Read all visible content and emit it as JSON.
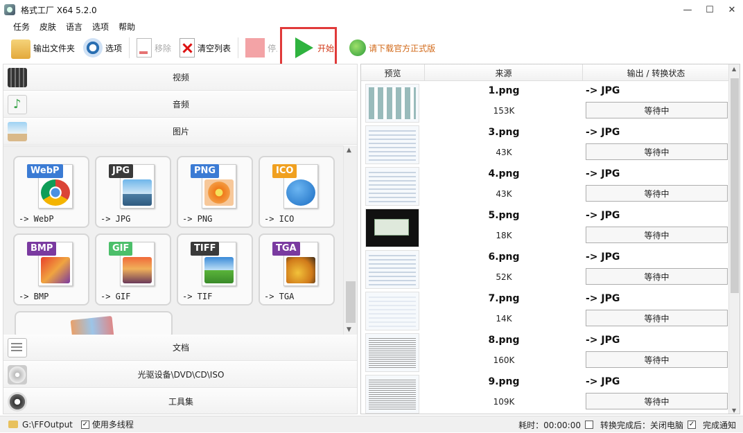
{
  "window": {
    "title": "格式工厂 X64 5.2.0",
    "min": "—",
    "max": "☐",
    "close": "✕"
  },
  "menu": [
    "任务",
    "皮肤",
    "语言",
    "选项",
    "帮助"
  ],
  "toolbar": {
    "output_folder": "输出文件夹",
    "options": "选项",
    "remove": "移除",
    "clear_list": "清空列表",
    "stop": "停止",
    "start": "开始",
    "download": "请下载官方正式版"
  },
  "categories": {
    "video": "视频",
    "audio": "音频",
    "image": "图片",
    "document": "文档",
    "disc": "光驱设备\\DVD\\CD\\ISO",
    "tools": "工具集"
  },
  "formats": [
    {
      "badge": "WebP",
      "label": "-> WebP",
      "color": "#3b7bd4"
    },
    {
      "badge": "JPG",
      "label": "-> JPG",
      "color": "#3a3a3a"
    },
    {
      "badge": "PNG",
      "label": "-> PNG",
      "color": "#3b7bd4"
    },
    {
      "badge": "ICO",
      "label": "-> ICO",
      "color": "#f0a020"
    },
    {
      "badge": "BMP",
      "label": "-> BMP",
      "color": "#7a3aa0"
    },
    {
      "badge": "GIF",
      "label": "-> GIF",
      "color": "#4cbf6a"
    },
    {
      "badge": "TIFF",
      "label": "-> TIF",
      "color": "#3a3a3a"
    },
    {
      "badge": "TGA",
      "label": "-> TGA",
      "color": "#7a3aa0"
    }
  ],
  "grid": {
    "headers": {
      "preview": "预览",
      "source": "来源",
      "output": "输出 / 转换状态"
    },
    "rows": [
      {
        "name": "1.png",
        "size": "153K",
        "out": "-> JPG",
        "status": "等待中"
      },
      {
        "name": "3.png",
        "size": "43K",
        "out": "-> JPG",
        "status": "等待中"
      },
      {
        "name": "4.png",
        "size": "43K",
        "out": "-> JPG",
        "status": "等待中"
      },
      {
        "name": "5.png",
        "size": "18K",
        "out": "-> JPG",
        "status": "等待中"
      },
      {
        "name": "6.png",
        "size": "52K",
        "out": "-> JPG",
        "status": "等待中"
      },
      {
        "name": "7.png",
        "size": "14K",
        "out": "-> JPG",
        "status": "等待中"
      },
      {
        "name": "8.png",
        "size": "160K",
        "out": "-> JPG",
        "status": "等待中"
      },
      {
        "name": "9.png",
        "size": "109K",
        "out": "-> JPG",
        "status": "等待中"
      }
    ]
  },
  "statusbar": {
    "output_path": "G:\\FFOutput",
    "multithread": "使用多线程",
    "elapsed": "耗时：00:00:00",
    "after_convert": "转换完成后：关闭电脑",
    "notify": "完成通知",
    "check": "✓"
  }
}
